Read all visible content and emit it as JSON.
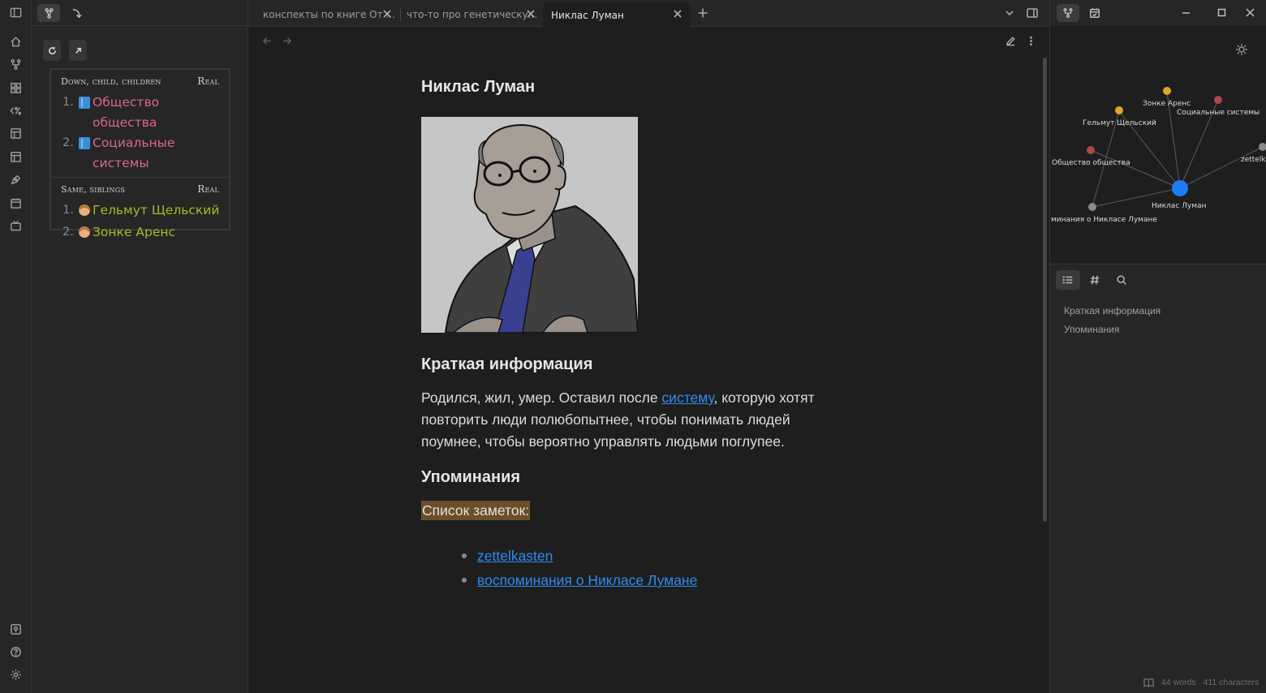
{
  "colors": {
    "link": "#2e8cf0",
    "pink_note": "#d9668f",
    "olive_note": "#a8b826",
    "highlight": "#6b4f2c",
    "graph_active": "#1e7bf2",
    "graph_yellow": "#e0a52a",
    "graph_red": "#b04646",
    "graph_gray": "#8a8a8a"
  },
  "ribbon": {
    "icons": [
      "home-icon",
      "git-fork-icon",
      "blocks-icon",
      "code-percent-icon",
      "layout-icon",
      "layout-2-icon",
      "pen-tool-icon",
      "calendar-icon",
      "tv-icon",
      "vault-icon",
      "help-icon",
      "settings-icon"
    ]
  },
  "matrix": {
    "down": {
      "header": "Down, child, children",
      "kind": "Real",
      "items": [
        {
          "num": "1.",
          "label": "Общество общества"
        },
        {
          "num": "2.",
          "label": "Социальные системы"
        }
      ]
    },
    "same": {
      "header": "Same, siblings",
      "kind": "Real",
      "items": [
        {
          "num": "1.",
          "label": "Гельмут Щельский"
        },
        {
          "num": "2.",
          "label": "Зонке Аренс"
        }
      ]
    }
  },
  "tabs": [
    {
      "title": "конспекты по книге От ..."
    },
    {
      "title": "что-то про генетическу..."
    },
    {
      "title": "Никлас Луман"
    }
  ],
  "note": {
    "title": "Никлас Луман",
    "section1": "Краткая информация",
    "para_part1": "Родился, жил, умер. Оставил после ",
    "para_link": "систему",
    "para_part2": ", которую хотят повторить люди полюбопытнее, чтобы понимать людей поумнее, чтобы вероятно управлять людьми поглупее.",
    "section2": "Упоминания",
    "highlight": "Список заметок:",
    "links": [
      "zettelkasten",
      "воспоминания о Никласе Лумане"
    ]
  },
  "graph": {
    "nodes": [
      {
        "label": "Зонке Аренс"
      },
      {
        "label": "Социальные системы"
      },
      {
        "label": "Гельмут Щельский"
      },
      {
        "label": "Общество общества"
      },
      {
        "label": "Никлас Луман"
      },
      {
        "label": "минания о Никласе Лумане"
      },
      {
        "label": "zettelk"
      }
    ]
  },
  "outline": {
    "items": [
      "Краткая информация",
      "Упоминания"
    ]
  },
  "status": {
    "words": "44 words",
    "chars": "411 characters"
  }
}
